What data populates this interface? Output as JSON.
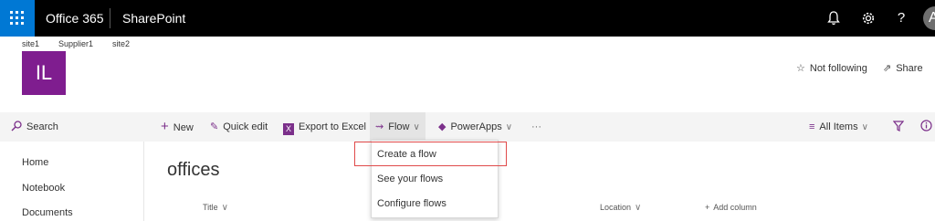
{
  "suite_bar": {
    "app_name": "Office 365",
    "product_name": "SharePoint",
    "avatar_initial": "A"
  },
  "site": {
    "links": [
      "site1",
      "Supplier1",
      "site2"
    ],
    "logo_text": "IL",
    "follow_label": "Not following",
    "share_label": "Share"
  },
  "search": {
    "placeholder": "Search"
  },
  "command_bar": {
    "new_label": "New",
    "quick_edit_label": "Quick edit",
    "export_label": "Export to Excel",
    "flow_label": "Flow",
    "powerapps_label": "PowerApps",
    "more_label": "···",
    "view_label": "All Items"
  },
  "left_nav": {
    "items": [
      "Home",
      "Notebook",
      "Documents"
    ]
  },
  "list": {
    "title": "offices",
    "columns": {
      "title": "Title",
      "location": "Location",
      "add": "Add column"
    }
  },
  "flow_menu": {
    "items": [
      "Create a flow",
      "See your flows",
      "Configure flows"
    ]
  },
  "colors": {
    "suite_bar": "#000000",
    "waffle": "#0078d4",
    "site_logo": "#7f1d8f",
    "highlight_box": "#e04a4a"
  }
}
